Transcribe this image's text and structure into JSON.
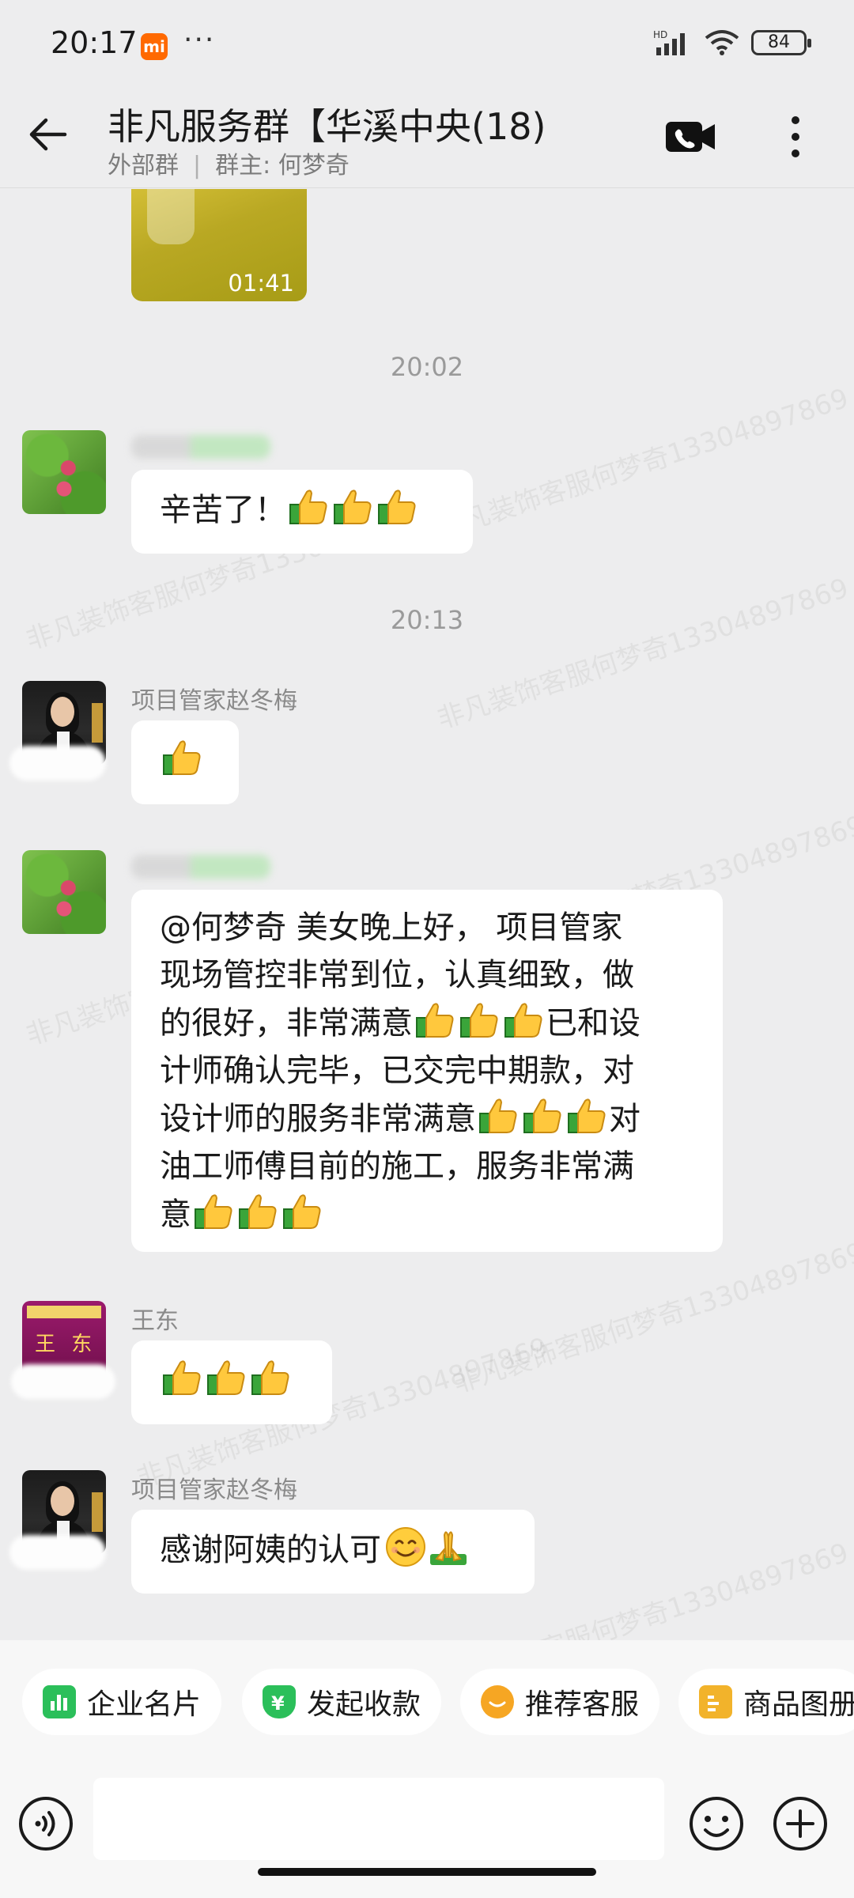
{
  "status_bar": {
    "time": "20:17",
    "mi_label": "mi",
    "dots": "···",
    "battery": "84"
  },
  "header": {
    "title": "非凡服务群【华溪中央(18)",
    "group_type": "外部群",
    "owner": "群主: 何梦奇"
  },
  "video": {
    "duration": "01:41"
  },
  "timestamps": [
    "20:02",
    "20:13"
  ],
  "watermark_text": "非凡装饰客服何梦奇13304897869",
  "messages": [
    {
      "sender": "",
      "text": "辛苦了！",
      "thumbs": 3
    },
    {
      "sender": "项目管家赵冬梅",
      "text": "",
      "thumbs": 1
    },
    {
      "sender": "",
      "lines": [
        "@何梦奇 美女晚上好， 项目管家",
        "现场管控非常到位，认真细致，做",
        "的很好，非常满意",
        "已和设",
        "计师确认完毕，已交完中期款，对",
        "设计师的服务非常满意",
        "对",
        "油工师傅目前的施工，服务非常满",
        "意"
      ]
    },
    {
      "sender": "王东",
      "text": "",
      "thumbs": 3,
      "avatar_text": "王 东"
    },
    {
      "sender": "项目管家赵冬梅",
      "text": "感谢阿姨的认可"
    }
  ],
  "quick_actions": [
    "企业名片",
    "发起收款",
    "推荐客服",
    "商品图册"
  ],
  "colors": {
    "background": "#ededee",
    "bubble": "#ffffff",
    "chip_green": "#2bbf5a",
    "chip_orange": "#f6a623",
    "chip_yellow": "#f2b32b"
  }
}
